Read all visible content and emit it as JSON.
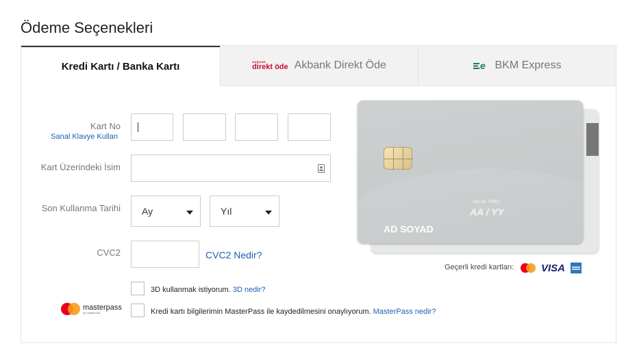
{
  "page_title": "Ödeme Seçenekleri",
  "tabs": [
    {
      "label": "Kredi Kartı / Banka Kartı",
      "active": true
    },
    {
      "label": "Akbank Direkt Öde",
      "logo_small": "AKBANK",
      "logo_big": "direkt öde"
    },
    {
      "label": "BKM Express"
    }
  ],
  "form": {
    "card_no_label": "Kart No",
    "virtual_keyboard_link": "Sanal Klavye Kullan",
    "card_name_label": "Kart Üzerindeki İsim",
    "expiry_label": "Son Kullanma Tarihi",
    "month_value": "Ay",
    "year_value": "Yıl",
    "cvc_label": "CVC2",
    "cvc_link": "CVC2 Nedir?"
  },
  "checks": {
    "three_d_text": "3D kullanmak istiyorum.",
    "three_d_link": "3D nedir?",
    "masterpass_text": "Kredi kartı bilgilerimin MasterPass ile kaydedilmesini onaylıyorum.",
    "masterpass_link": "MasterPass nedir?",
    "masterpass_logo_text": "masterpass",
    "masterpass_logo_sub": "by mastercard"
  },
  "card": {
    "valid_thru": "VALID THRU",
    "expiry_placeholder": "AA / YY",
    "holder_placeholder": "AD SOYAD"
  },
  "valid_cards": {
    "label": "Geçerli kredi kartları:",
    "visa": "VISA"
  },
  "colors": {
    "link": "#1a5fb4",
    "mastercard_red": "#eb001b",
    "mastercard_yellow": "#f79e1b",
    "akbank_red": "#c8102e",
    "bkm_green": "#1f7a5a"
  }
}
